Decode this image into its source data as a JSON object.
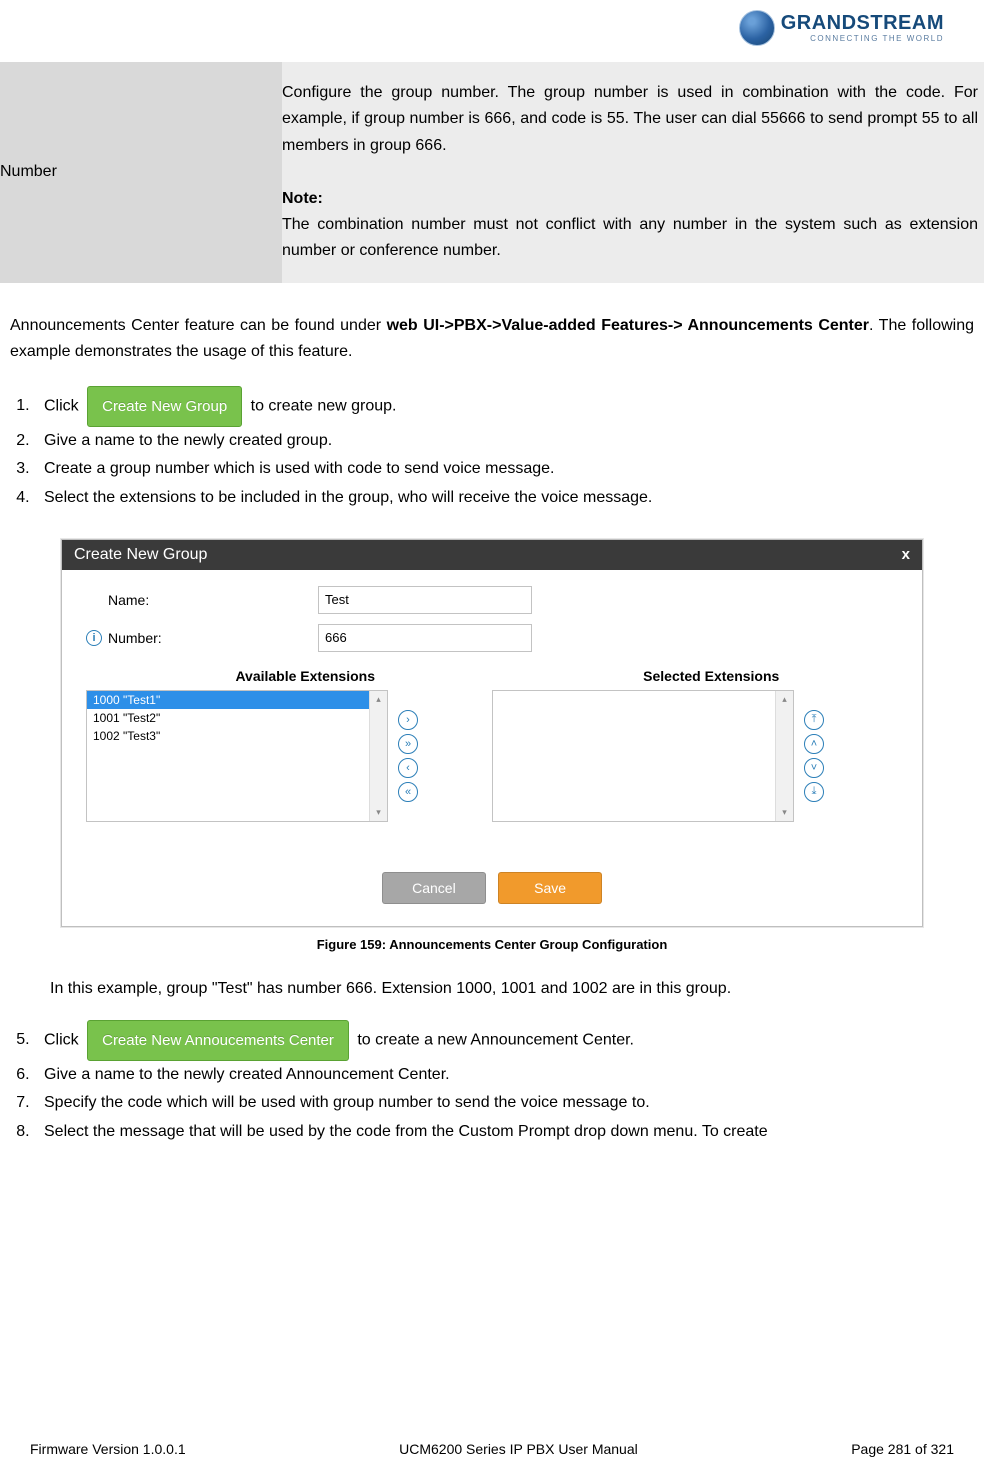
{
  "branding": {
    "company": "GRANDSTREAM",
    "tagline": "CONNECTING THE WORLD"
  },
  "param_table": {
    "label": "Number",
    "desc_line1": "Configure the group number. The group number is used in combination with the code. For example, if group number is 666, and code is 55. The user can dial 55666 to send prompt 55 to all members in group 666.",
    "note_label": "Note:",
    "note_text": "The combination number must not conflict with any number in the system such as extension number or conference number."
  },
  "intro_para": {
    "prefix": "Announcements Center feature can be found under ",
    "bold_path": "web UI->PBX->Value-added Features-> Announcements Center",
    "suffix": ". The following example demonstrates the usage of this feature."
  },
  "buttons": {
    "create_group": "Create New Group",
    "create_center": "Create New Annoucements Center",
    "cancel": "Cancel",
    "save": "Save"
  },
  "steps_a": {
    "s1_pre": "Click ",
    "s1_post": " to create new group.",
    "s2": "Give a name to the newly created group.",
    "s3": "Create a group number which is used with code to send voice message.",
    "s4": "Select the extensions to be included in the group, who will receive the voice message."
  },
  "dialog": {
    "title": "Create New Group",
    "close": "x",
    "name_label": "Name:",
    "name_value": "Test",
    "number_label": "Number:",
    "number_value": "666",
    "avail_header": "Available Extensions",
    "sel_header": "Selected Extensions",
    "ext1": "1000 \"Test1\"",
    "ext2": "1001 \"Test2\"",
    "ext3": "1002 \"Test3\""
  },
  "figure_caption": "Figure 159: Announcements Center Group Configuration",
  "example_para": "In this example, group \"Test\" has number 666. Extension 1000, 1001 and 1002 are in this group.",
  "steps_b": {
    "s5_pre": "Click ",
    "s5_post": " to create a new Announcement Center.",
    "s6": "Give a name to the newly created Announcement Center.",
    "s7": "Specify the code which will be used with group number to send the voice message to.",
    "s8": "Select the message that will be used by the code from the Custom Prompt drop down menu. To create"
  },
  "footer": {
    "left": "Firmware Version 1.0.0.1",
    "center": "UCM6200 Series IP PBX User Manual",
    "right": "Page 281 of 321"
  }
}
